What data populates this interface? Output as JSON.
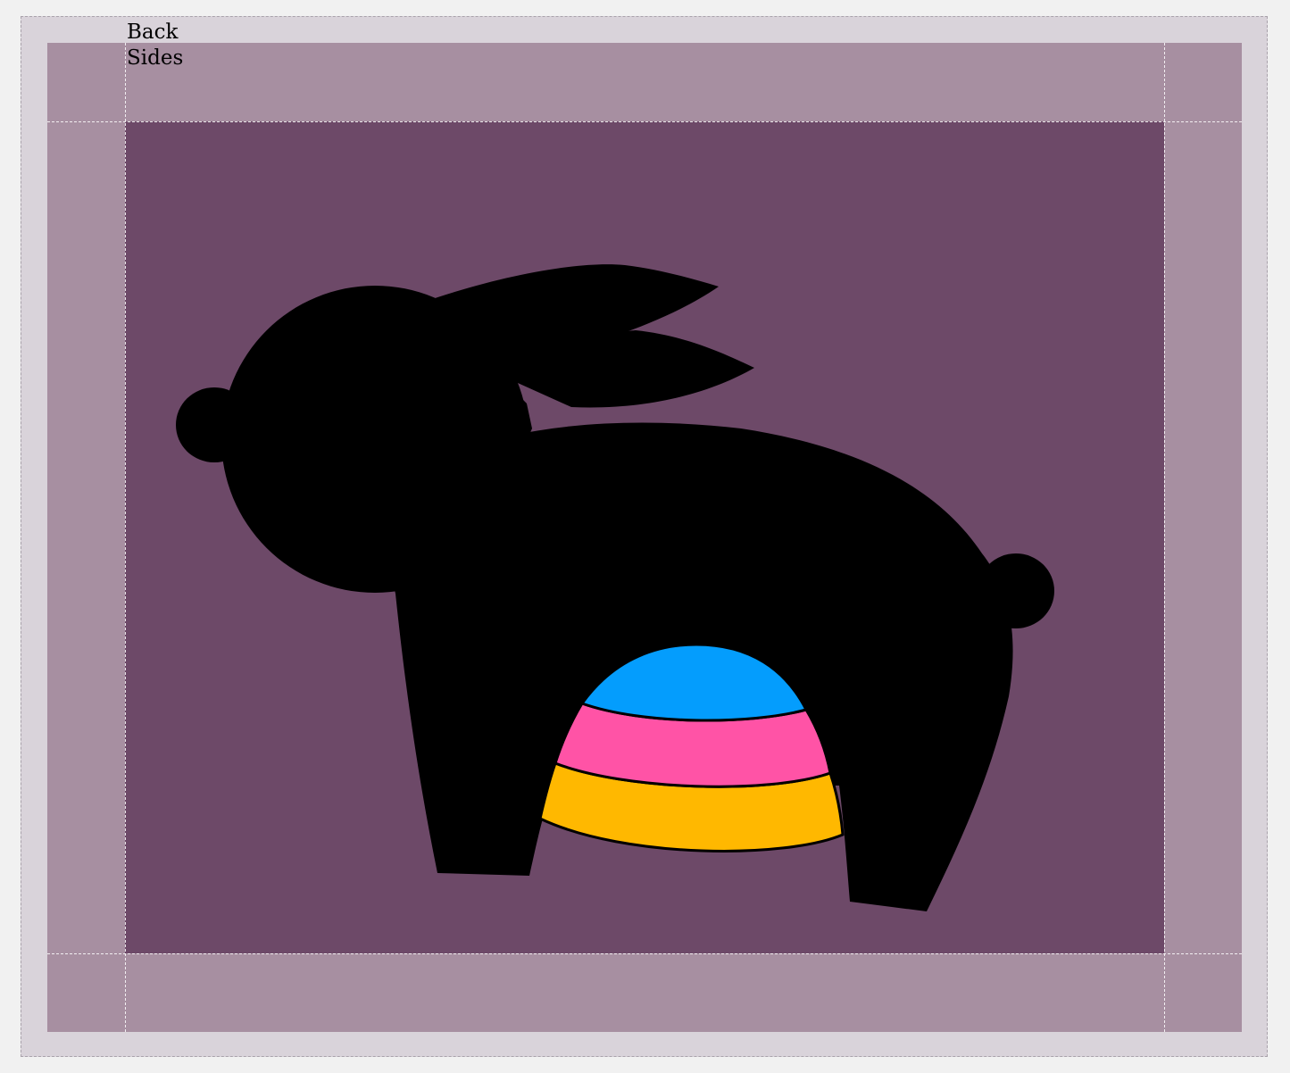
{
  "labels": {
    "line1": "Back",
    "line2": "Sides"
  },
  "colors": {
    "page_background": "#f1f1f1",
    "outer_frame": "#d9d3da",
    "bleed_area": "#a78fa1",
    "trim_area": "#6d4968",
    "bunny": "#000000",
    "egg_band_top": "#049dfd",
    "egg_band_middle": "#ff53a6",
    "egg_band_bottom": "#ffb800"
  },
  "artwork": {
    "subject": "bunny-silhouette-with-striped-egg",
    "egg_bands": 3
  }
}
